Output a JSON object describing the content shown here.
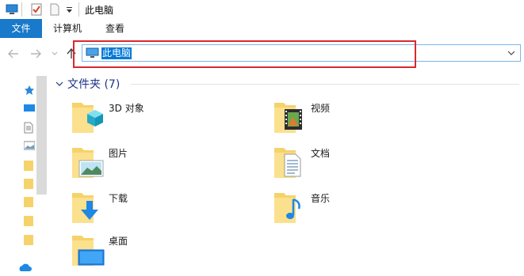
{
  "window": {
    "title": "此电脑"
  },
  "ribbon": {
    "tabs": [
      {
        "label": "文件"
      },
      {
        "label": "计算机"
      },
      {
        "label": "查看"
      }
    ]
  },
  "address": {
    "path": "此电脑"
  },
  "group": {
    "title": "文件夹 (7)"
  },
  "folders": [
    {
      "label": "3D 对象",
      "icon": "3d-objects-folder-icon"
    },
    {
      "label": "视频",
      "icon": "videos-folder-icon"
    },
    {
      "label": "图片",
      "icon": "pictures-folder-icon"
    },
    {
      "label": "文档",
      "icon": "documents-folder-icon"
    },
    {
      "label": "下载",
      "icon": "downloads-folder-icon"
    },
    {
      "label": "音乐",
      "icon": "music-folder-icon"
    },
    {
      "label": "桌面",
      "icon": "desktop-folder-icon"
    }
  ],
  "colors": {
    "accent": "#1979ca",
    "selection": "#0078d7",
    "highlight_box": "#d9282f",
    "folder": "#f6d26a"
  }
}
